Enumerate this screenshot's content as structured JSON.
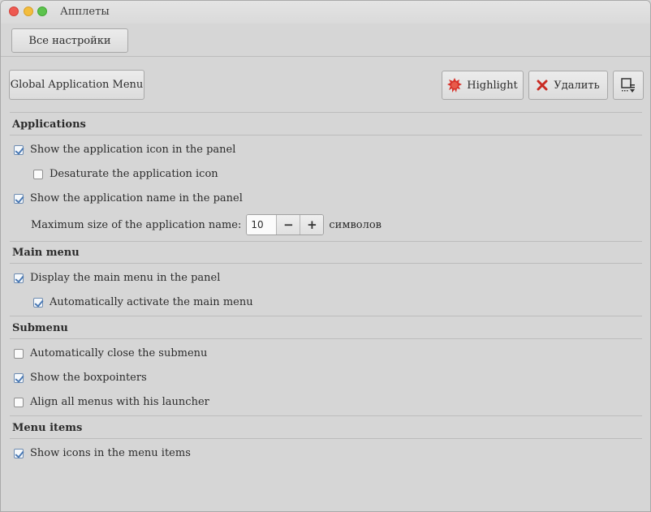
{
  "window": {
    "title": "Апплеты"
  },
  "toolbar": {
    "all_settings_label": "Все настройки"
  },
  "applet": {
    "name": "Global Application Menu",
    "highlight_label": "Highlight",
    "remove_label": "Удалить"
  },
  "sections": {
    "applications": {
      "title": "Applications",
      "show_icon": "Show the application icon in the panel",
      "desaturate_icon": "Desaturate the application icon",
      "show_name": "Show the application name in the panel",
      "max_size_label": "Maximum size of the application name:",
      "max_size_value": "10",
      "max_size_unit": "символов"
    },
    "main_menu": {
      "title": "Main menu",
      "display_main_menu": "Display the main menu in the panel",
      "auto_activate": "Automatically activate the main menu"
    },
    "submenu": {
      "title": "Submenu",
      "auto_close": "Automatically close the submenu",
      "show_boxpointers": "Show the boxpointers",
      "align_menus": "Align all menus with his launcher"
    },
    "menu_items": {
      "title": "Menu items",
      "show_icons": "Show icons in the menu items"
    }
  },
  "checkbox_states": {
    "show_icon": true,
    "desaturate_icon": false,
    "show_name": true,
    "display_main_menu": true,
    "auto_activate": true,
    "auto_close": false,
    "show_boxpointers": true,
    "align_menus": false,
    "show_icons": true
  },
  "spin": {
    "minus": "−",
    "plus": "+"
  },
  "icons": {
    "highlight": "highlight-starburst-icon",
    "remove": "remove-x-icon",
    "more": "export-settings-icon"
  },
  "colors": {
    "highlight_icon": "#d8332b",
    "remove_icon": "#c92a22",
    "check": "#4a79b4"
  }
}
